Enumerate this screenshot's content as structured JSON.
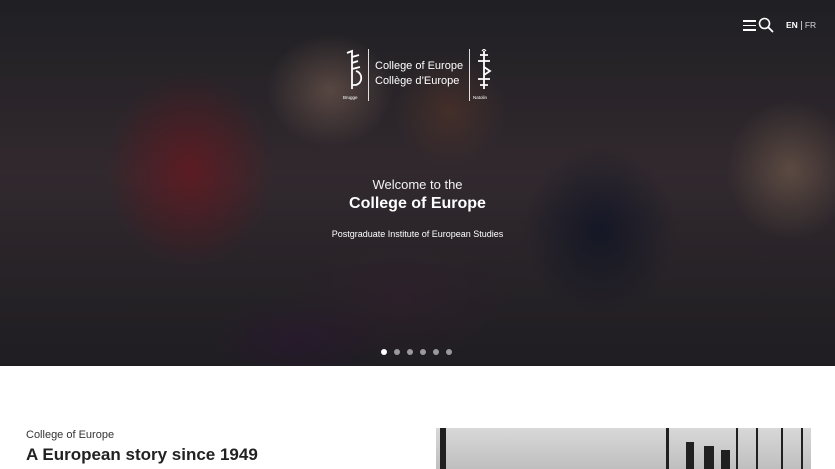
{
  "header": {
    "lang_active": "EN",
    "lang_other": "FR",
    "menu_icon": "hamburger-menu-icon",
    "search_icon": "search-icon"
  },
  "logo": {
    "name_en": "College of Europe",
    "name_fr": "Collège d’Europe",
    "city_left": "Brugge",
    "city_right": "Natolin"
  },
  "hero": {
    "welcome": "Welcome to the",
    "title": "College of Europe",
    "subtitle": "Postgraduate Institute of European Studies",
    "slides_total": 6,
    "slide_active": 1
  },
  "intro": {
    "kicker": "College of Europe",
    "heading": "A European story since 1949"
  },
  "colors": {
    "text_dark": "#222222",
    "hero_overlay": "#2a2a30",
    "white": "#ffffff"
  }
}
